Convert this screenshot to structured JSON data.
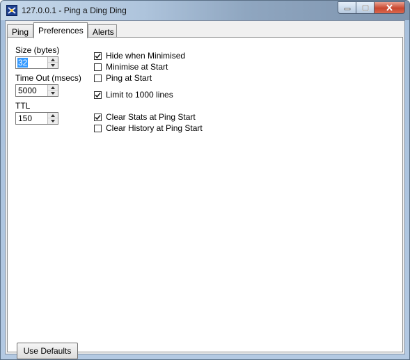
{
  "window": {
    "title": "127.0.0.1 - Ping a Ding Ding"
  },
  "tabs": [
    {
      "label": "Ping"
    },
    {
      "label": "Preferences"
    },
    {
      "label": "Alerts"
    }
  ],
  "active_tab": "Preferences",
  "fields": {
    "size": {
      "label": "Size (bytes)",
      "value": "32"
    },
    "timeout": {
      "label": "Time Out (msecs)",
      "value": "5000"
    },
    "ttl": {
      "label": "TTL",
      "value": "150"
    }
  },
  "options": [
    {
      "label": "Hide when Minimised",
      "checked": true
    },
    {
      "label": "Minimise at Start",
      "checked": false
    },
    {
      "label": "Ping at Start",
      "checked": false
    },
    {
      "label": "Limit to 1000 lines",
      "checked": true
    },
    {
      "label": "Clear Stats at Ping Start",
      "checked": true
    },
    {
      "label": "Clear History at Ping Start",
      "checked": false
    }
  ],
  "buttons": {
    "use_defaults": "Use Defaults"
  },
  "icons": {
    "app": "ping-app-icon",
    "minimize": "minimize-icon",
    "maximize": "maximize-icon",
    "close": "close-icon",
    "check": "checkmark-icon"
  }
}
